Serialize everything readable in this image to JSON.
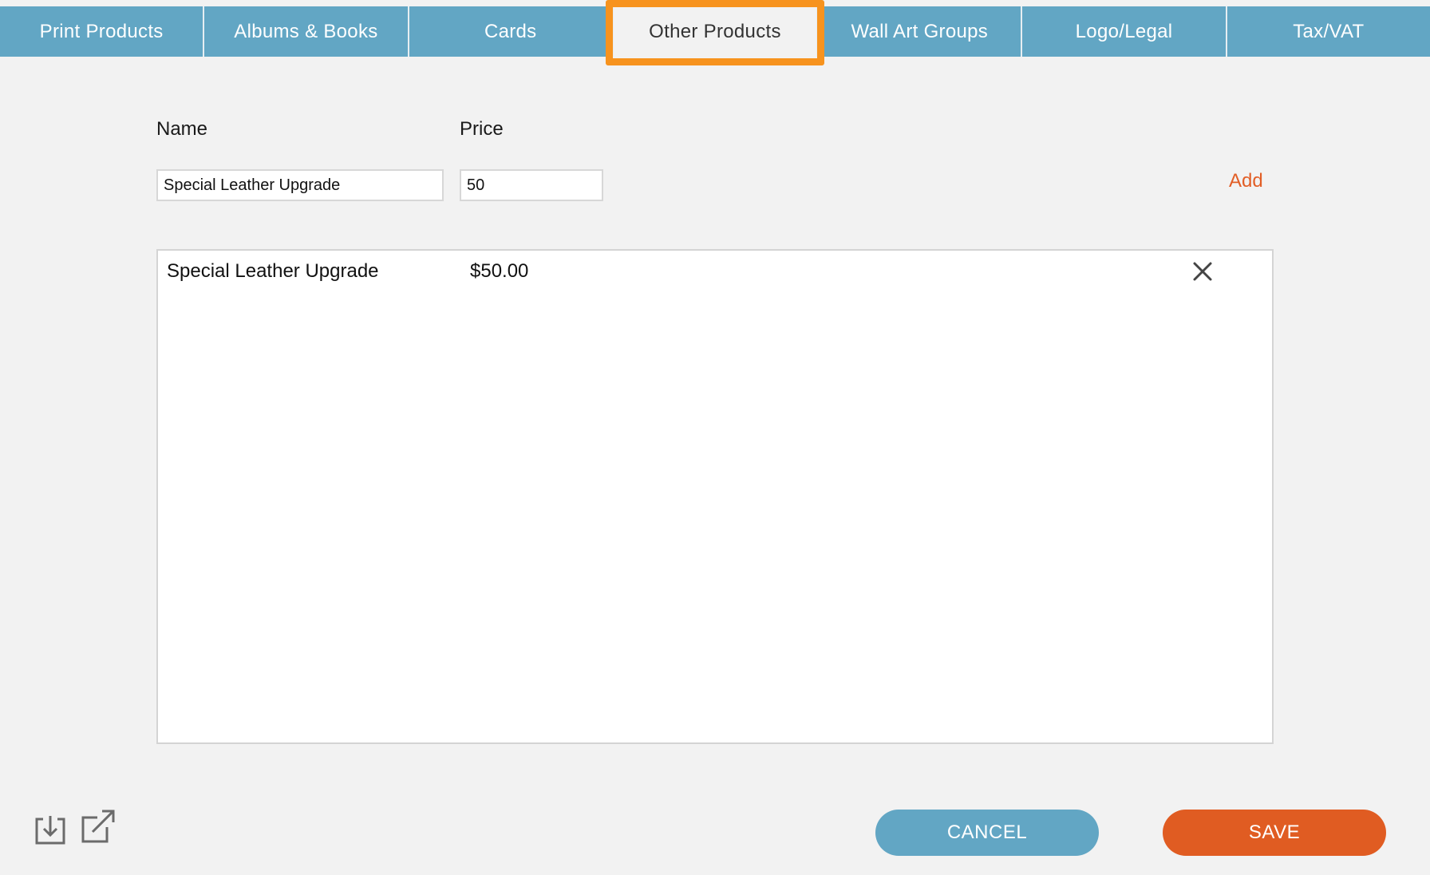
{
  "tabs": [
    {
      "label": "Print Products"
    },
    {
      "label": "Albums & Books"
    },
    {
      "label": "Cards"
    },
    {
      "label": "Other Products"
    },
    {
      "label": "Wall Art Groups"
    },
    {
      "label": "Logo/Legal"
    },
    {
      "label": "Tax/VAT"
    }
  ],
  "active_tab": "Other Products",
  "form": {
    "name_label": "Name",
    "price_label": "Price",
    "name_value": "Special Leather Upgrade",
    "price_value": "50",
    "add_label": "Add"
  },
  "list": {
    "items": [
      {
        "name": "Special Leather Upgrade",
        "price": "$50.00"
      }
    ]
  },
  "icons": {
    "import": "import-icon",
    "export": "export-icon",
    "remove": "close-icon"
  },
  "footer": {
    "cancel_label": "CANCEL",
    "save_label": "SAVE"
  },
  "colors": {
    "tab_bar": "#62a6c4",
    "active_highlight": "#f7931e",
    "add_link": "#e25e26",
    "cancel_button": "#62a6c4",
    "save_button": "#e05c22"
  }
}
